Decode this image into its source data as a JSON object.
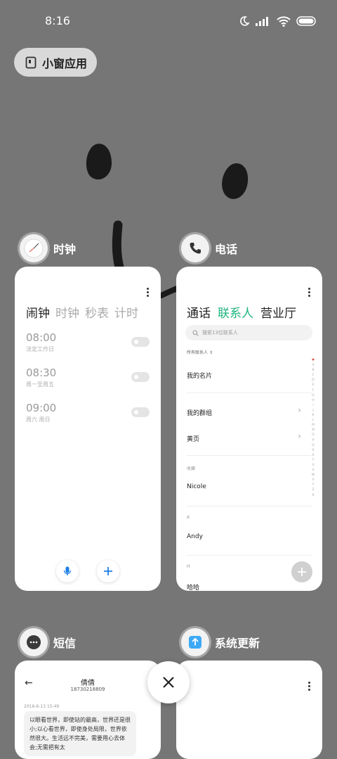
{
  "status": {
    "time": "8:16"
  },
  "pill": {
    "label": "小窗应用"
  },
  "apps": {
    "clock": {
      "name": "时钟",
      "tabs": [
        "闹钟",
        "时钟",
        "秒表",
        "计时"
      ],
      "alarms": [
        {
          "time": "08:00",
          "sub": "法定工作日"
        },
        {
          "time": "08:30",
          "sub": "周一至周五"
        },
        {
          "time": "09:00",
          "sub": "周六 周日"
        }
      ]
    },
    "phone": {
      "name": "电话",
      "tabs": [
        "通话",
        "联系人",
        "营业厅"
      ],
      "search_placeholder": "搜索13位联系人",
      "filter": "所有联系人",
      "my_card": "我的名片",
      "my_group": "我的群组",
      "yellow_pages": "黄页",
      "favorites": "收藏",
      "fav_contact": "Nicole",
      "section_a": "A",
      "contact_a": "Andy",
      "section_h": "H",
      "contact_h": "哈哈",
      "alphabet": [
        "A",
        "B",
        "C",
        "D",
        "E",
        "F",
        "G",
        "H",
        "I",
        "J",
        "K",
        "L",
        "M",
        "N",
        "O",
        "P",
        "Q",
        "R",
        "S",
        "T",
        "U",
        "V",
        "W",
        "X",
        "Y",
        "Z",
        "#"
      ]
    },
    "sms": {
      "name": "短信",
      "contact_name": "倩倩",
      "contact_number": "18730218809",
      "timestamp": "2016-6-13 15:49",
      "message": "以眼看世界，即使站的最高，世界还是很小;以心看世界，即使身处局限，世界依然很大。生活远不完美，需要用心去体会;无需把有太"
    },
    "update": {
      "name": "系统更新"
    }
  },
  "colors": {
    "accent_green": "#1fb57e",
    "accent_blue": "#1d7ee6",
    "background": "#767676"
  }
}
